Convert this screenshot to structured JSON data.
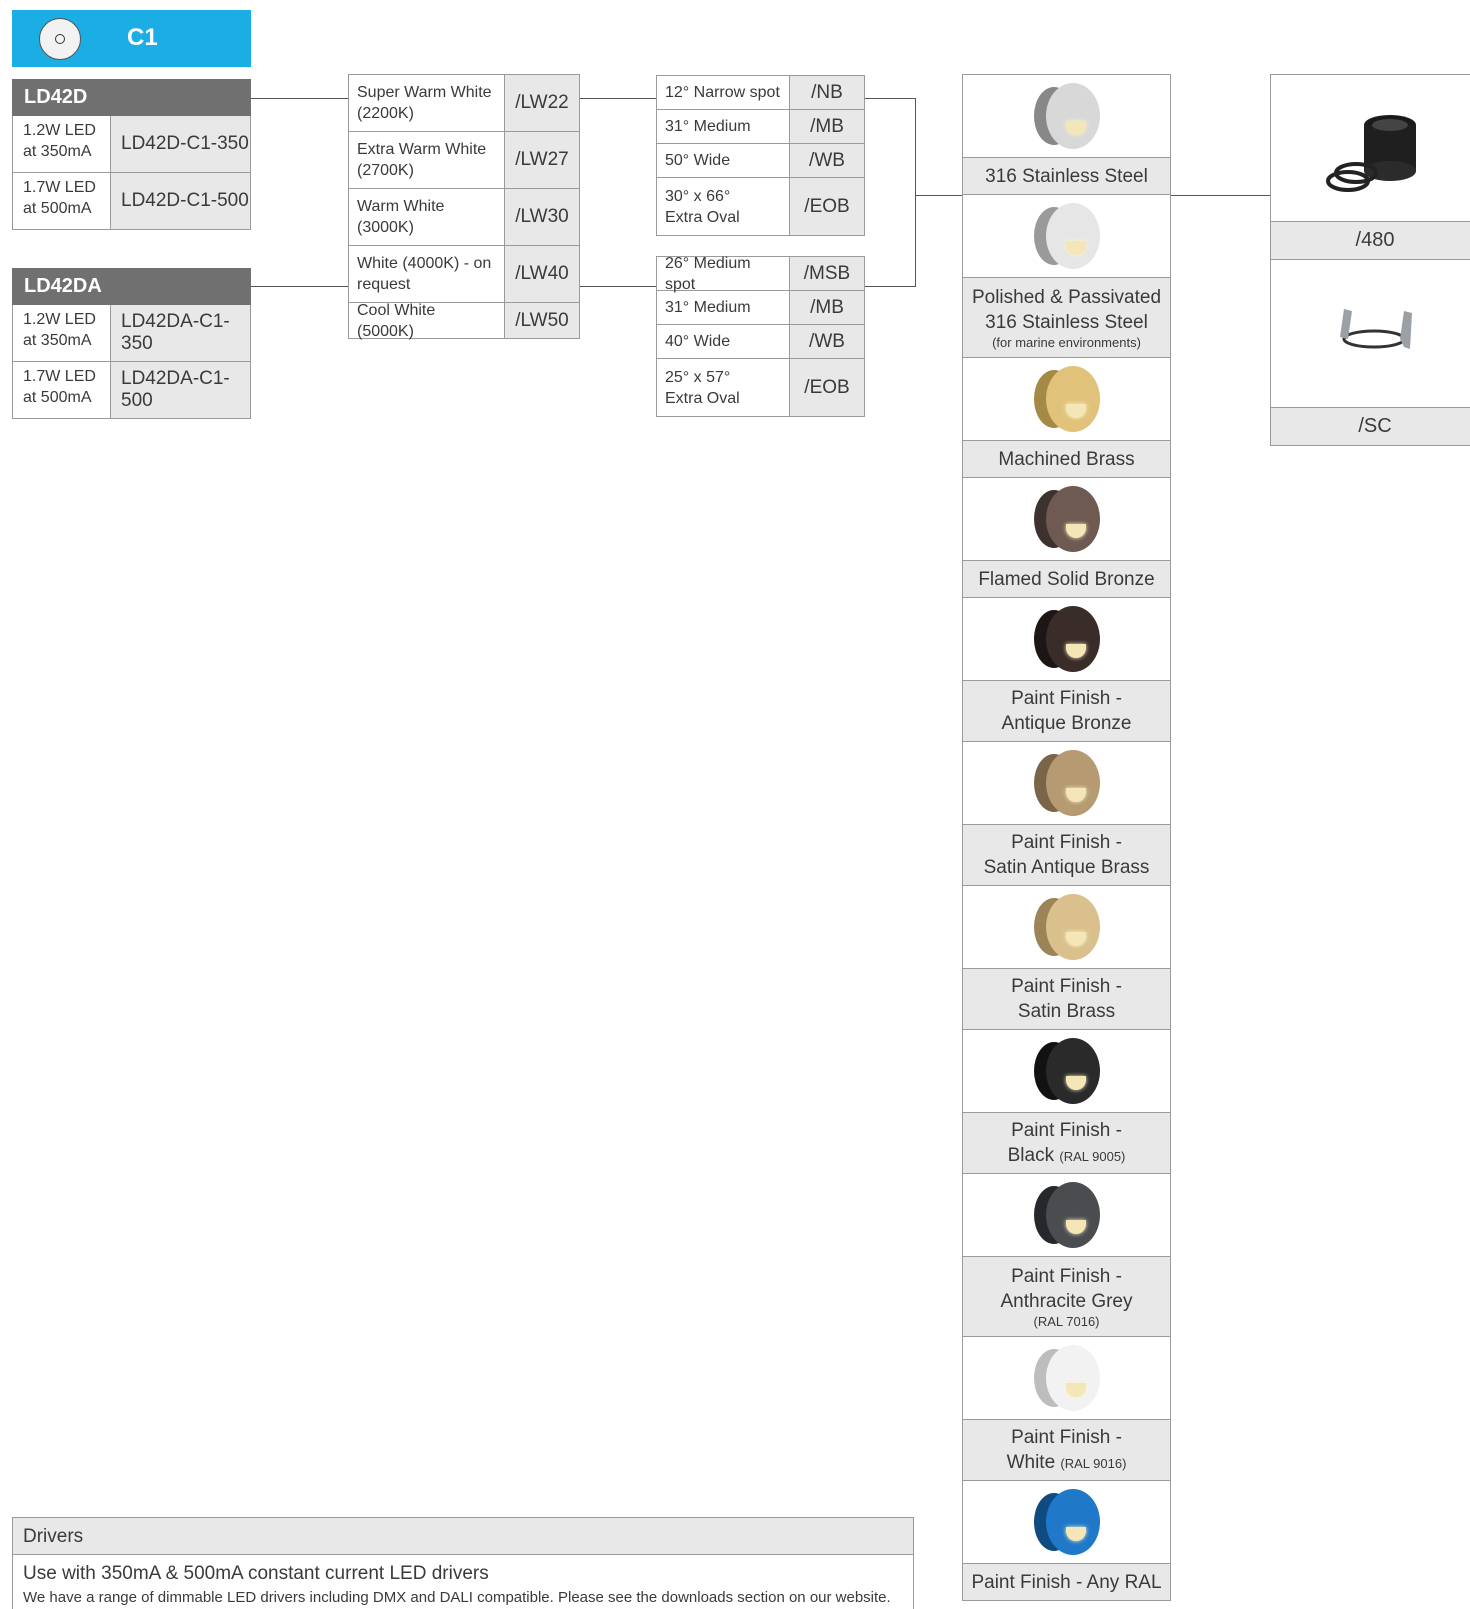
{
  "header": {
    "code": "C1",
    "accent": "#1aaee4"
  },
  "products": [
    {
      "name": "LD42D",
      "rows": [
        {
          "power": "1.2W LED",
          "current": "at 350mA",
          "code": "LD42D-C1-350"
        },
        {
          "power": "1.7W LED",
          "current": "at 500mA",
          "code": "LD42D-C1-500"
        }
      ]
    },
    {
      "name": "LD42DA",
      "rows": [
        {
          "power": "1.2W LED",
          "current": "at 350mA",
          "code": "LD42DA-C1-350"
        },
        {
          "power": "1.7W LED",
          "current": "at 500mA",
          "code": "LD42DA-C1-500"
        }
      ]
    }
  ],
  "colour_temps": [
    {
      "l1": "Super Warm White",
      "l2": "(2200K)",
      "code": "/LW22"
    },
    {
      "l1": "Extra Warm White",
      "l2": "(2700K)",
      "code": "/LW27"
    },
    {
      "l1": "Warm White",
      "l2": "(3000K)",
      "code": "/LW30"
    },
    {
      "l1": "White (4000K) - on",
      "l2": "request",
      "code": "/LW40"
    },
    {
      "l1": "Cool White (5000K)",
      "l2": "",
      "code": "/LW50"
    }
  ],
  "beams_a": [
    {
      "l1": "12° Narrow spot",
      "l2": "",
      "code": "/NB"
    },
    {
      "l1": "31° Medium",
      "l2": "",
      "code": "/MB"
    },
    {
      "l1": "50° Wide",
      "l2": "",
      "code": "/WB"
    },
    {
      "l1": "30° x 66°",
      "l2": "Extra Oval",
      "code": "/EOB"
    }
  ],
  "beams_b": [
    {
      "l1": "26° Medium spot",
      "l2": "",
      "code": "/MSB"
    },
    {
      "l1": "31° Medium",
      "l2": "",
      "code": "/MB"
    },
    {
      "l1": "40° Wide",
      "l2": "",
      "code": "/WB"
    },
    {
      "l1": "25° x 57°",
      "l2": "Extra Oval",
      "code": "/EOB"
    }
  ],
  "finishes": [
    {
      "l1": "316 Stainless Steel",
      "l2": "",
      "small": "",
      "cap": "#d8d8d8",
      "rim": "#888888"
    },
    {
      "l1": "Polished & Passivated",
      "l2": "316 Stainless Steel",
      "small": "(for marine environments)",
      "cap": "#e6e6e6",
      "rim": "#9a9a9a"
    },
    {
      "l1": "Machined Brass",
      "l2": "",
      "small": "",
      "cap": "#e0c27a",
      "rim": "#a58a45"
    },
    {
      "l1": "Flamed Solid Bronze",
      "l2": "",
      "small": "",
      "cap": "#6e5a50",
      "rim": "#3d322d"
    },
    {
      "l1": "Paint Finish -",
      "l2": "Antique Bronze",
      "small": "",
      "cap": "#3a2c28",
      "rim": "#1d1614"
    },
    {
      "l1": "Paint Finish -",
      "l2": "Satin Antique Brass",
      "small": "",
      "cap": "#b59a72",
      "rim": "#7a6548"
    },
    {
      "l1": "Paint Finish -",
      "l2": "Satin Brass",
      "small": "",
      "cap": "#d9c08c",
      "rim": "#9c8458"
    },
    {
      "l1": "Paint Finish -",
      "l2": "Black",
      "small": "(RAL 9005)",
      "cap": "#2a2a2a",
      "rim": "#121212"
    },
    {
      "l1": "Paint Finish -",
      "l2": "Anthracite Grey",
      "small": "(RAL 7016)",
      "cap": "#4a4c50",
      "rim": "#26282b"
    },
    {
      "l1": "Paint Finish -",
      "l2": "White",
      "small": "(RAL 9016)",
      "cap": "#f2f2f2",
      "rim": "#bdbdbd"
    },
    {
      "l1": "Paint Finish - Any RAL",
      "l2": "",
      "small": "",
      "cap": "#1f78c8",
      "rim": "#0f4a80"
    }
  ],
  "accessories": [
    {
      "code": "/480",
      "icon": "grommet-rings-icon"
    },
    {
      "code": "/SC",
      "icon": "spring-clip-icon"
    }
  ],
  "drivers": {
    "title": "Drivers",
    "line1": "Use with 350mA & 500mA constant current LED drivers",
    "line2": "We have a range of dimmable LED drivers including DMX and DALI compatible. Please see the downloads section on our website."
  }
}
